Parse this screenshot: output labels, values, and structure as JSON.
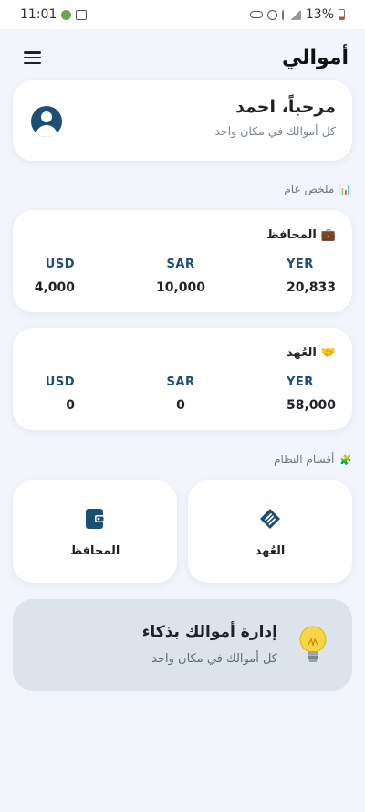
{
  "status_bar": {
    "time": "11:01",
    "battery": "13%"
  },
  "app_bar": {
    "title": "أموالي",
    "menu_icon": "hamburger-menu-icon"
  },
  "welcome": {
    "title": "مرحباً، احمد",
    "subtitle": "كل أموالك في مكان واحد",
    "avatar_icon": "user-avatar-icon"
  },
  "summary_section": {
    "label": "ملخص عام",
    "icon": "bar-chart-icon"
  },
  "wallets_card": {
    "title": "المحافظ",
    "icon": "briefcase-icon",
    "columns": [
      {
        "currency": "YER",
        "amount": "20,833"
      },
      {
        "currency": "SAR",
        "amount": "10,000"
      },
      {
        "currency": "USD",
        "amount": "4,000"
      }
    ]
  },
  "custody_card": {
    "title": "العُهد",
    "icon": "handshake-icon",
    "columns": [
      {
        "currency": "YER",
        "amount": "58,000"
      },
      {
        "currency": "SAR",
        "amount": "0"
      },
      {
        "currency": "USD",
        "amount": "0"
      }
    ]
  },
  "sections": {
    "label": "أقسام النظام",
    "icon": "puzzle-icon",
    "items": [
      {
        "label": "العُهد",
        "icon": "handshake-icon"
      },
      {
        "label": "المحافظ",
        "icon": "wallet-icon"
      }
    ]
  },
  "tip": {
    "title": "إدارة أموالك بذكاء",
    "subtitle": "كل أموالك في مكان واحد",
    "icon": "lightbulb-icon"
  },
  "colors": {
    "background": "#f2f5fb",
    "primary": "#1d4e73",
    "card": "#ffffff",
    "tip_card": "#dde3ea"
  }
}
